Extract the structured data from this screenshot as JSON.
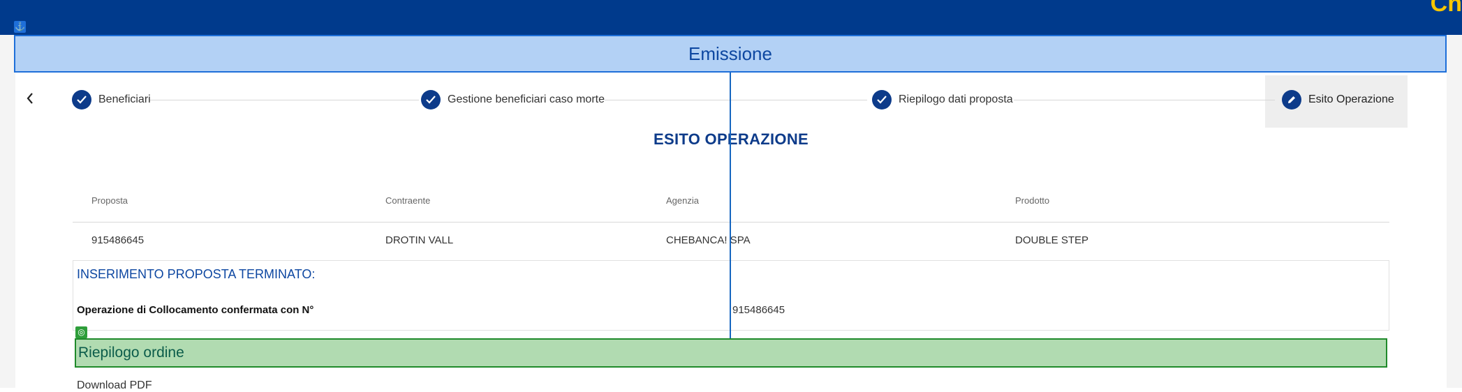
{
  "header": {
    "brand": "Ch"
  },
  "band": {
    "title": "Emissione"
  },
  "stepper": {
    "steps": [
      {
        "label": "Beneficiari",
        "icon": "check-icon"
      },
      {
        "label": "Gestione beneficiari caso morte",
        "icon": "check-icon"
      },
      {
        "label": "Riepilogo dati proposta",
        "icon": "check-icon"
      },
      {
        "label": "Esito Operazione",
        "icon": "pencil-icon"
      }
    ]
  },
  "main": {
    "title": "ESITO OPERAZIONE",
    "table": {
      "headers": [
        "Proposta",
        "Contraente",
        "Agenzia",
        "Prodotto"
      ],
      "row": [
        "915486645",
        "DROTIN VALL",
        "CHEBANCA! SPA",
        "DOUBLE STEP"
      ]
    },
    "result": {
      "title": "INSERIMENTO PROPOSTA TERMINATO:",
      "label": "Operazione di Collocamento confermata con N°",
      "value": "915486645"
    },
    "summary": {
      "title": "Riepilogo ordine",
      "download": "Download PDF"
    }
  },
  "colors": {
    "primary": "#003a8c",
    "accent": "#f7c600",
    "band_bg": "#b3d1f5",
    "summary_bg": "#b1dbb1"
  }
}
